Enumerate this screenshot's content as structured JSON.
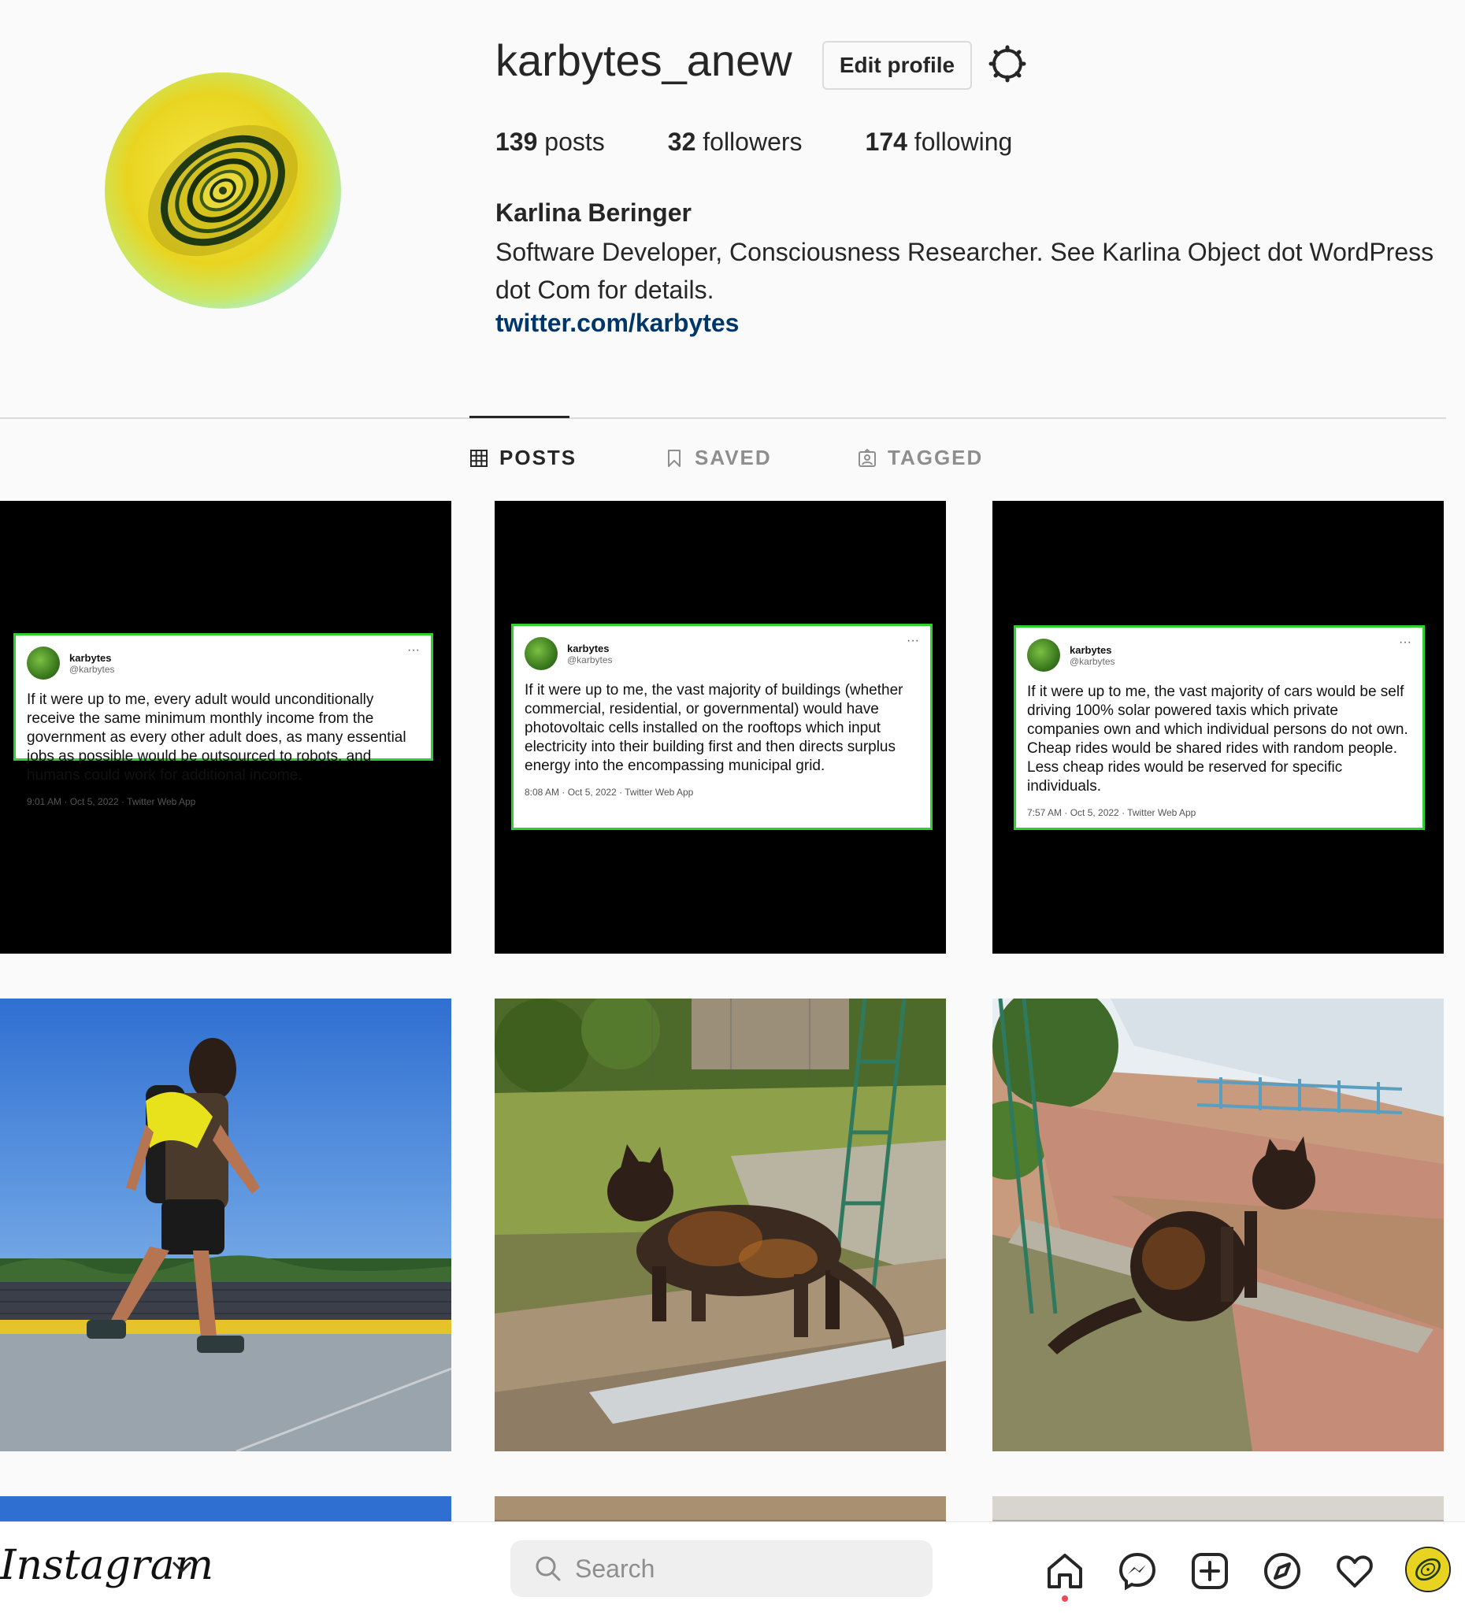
{
  "profile": {
    "username": "karbytes_anew",
    "edit_label": "Edit profile",
    "stats": {
      "posts_n": "139",
      "posts_l": "posts",
      "followers_n": "32",
      "followers_l": "followers",
      "following_n": "174",
      "following_l": "following"
    },
    "full_name": "Karlina Beringer",
    "bio": "Software Developer, Consciousness Researcher. See Karlina Object dot WordPress dot Com for details.",
    "link": "twitter.com/karbytes"
  },
  "tabs": {
    "posts": "POSTS",
    "saved": "SAVED",
    "tagged": "TAGGED"
  },
  "tweets": [
    {
      "name": "karbytes",
      "handle": "@karbytes",
      "dots": "···",
      "text": "If it were up to me, every adult would unconditionally receive the same minimum monthly income from the government as every other adult does, as many essential jobs as possible would be outsourced to robots, and humans could work for additional income.",
      "meta": "9:01 AM · Oct 5, 2022 · Twitter Web App"
    },
    {
      "name": "karbytes",
      "handle": "@karbytes",
      "dots": "···",
      "text": "If it were up to me, the vast majority of buildings (whether commercial, residential, or governmental) would have photovoltaic cells installed on the rooftops which input electricity into their building first and then directs surplus energy into the encompassing municipal grid.",
      "meta": "8:08 AM · Oct 5, 2022 · Twitter Web App"
    },
    {
      "name": "karbytes",
      "handle": "@karbytes",
      "dots": "···",
      "text": "If it were up to me, the vast majority of cars would be self driving 100% solar powered taxis which private companies own and which individual persons do not own. Cheap rides would be shared rides with random people. Less cheap rides would be reserved for specific individuals.",
      "meta": "7:57 AM · Oct 5, 2022 · Twitter Web App"
    }
  ],
  "bottom": {
    "logo": "Instagram",
    "search_placeholder": "Search"
  },
  "icons": [
    "gear-icon",
    "grid-icon",
    "bookmark-icon",
    "tag-icon",
    "chevron-down-icon",
    "search-icon",
    "home-icon",
    "messenger-icon",
    "new-post-icon",
    "explore-icon",
    "heart-icon"
  ],
  "colors": {
    "link": "#00376b",
    "tweet_border": "#2ed12e",
    "notification_dot": "#ed4956"
  }
}
